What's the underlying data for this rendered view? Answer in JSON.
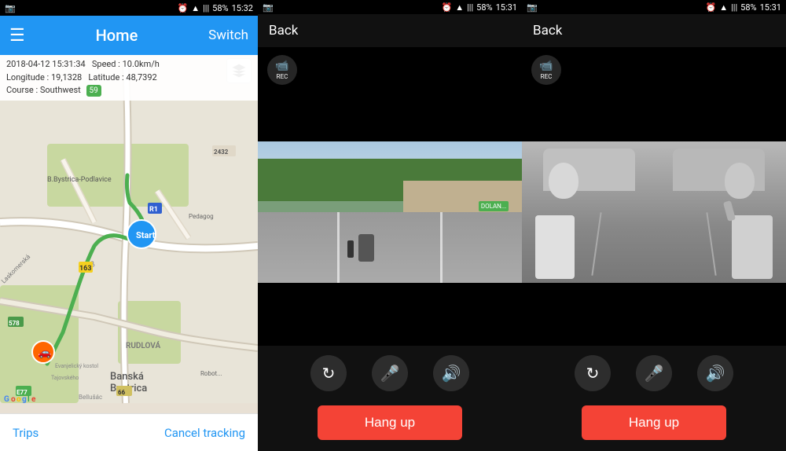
{
  "panel1": {
    "status_bar": {
      "left_icon": "📷",
      "time": "15:32",
      "battery": "58%",
      "signal_bars": "|||"
    },
    "top_bar": {
      "menu_icon": "☰",
      "title": "Home",
      "switch_label": "Switch"
    },
    "info": {
      "datetime": "2018-04-12  15:31:34",
      "speed_label": "Speed :",
      "speed_value": "10.0km/h",
      "longitude_label": "Longitude :",
      "longitude_value": "19,1328",
      "latitude_label": "Latitude :",
      "latitude_value": "48,7392",
      "course_label": "Course :",
      "course_value": "Southwest",
      "course_badge": "59"
    },
    "bottom_bar": {
      "trips_label": "Trips",
      "cancel_label": "Cancel tracking"
    }
  },
  "panel2": {
    "status_bar": {
      "left_icon": "📷",
      "time": "15:31",
      "battery": "58%"
    },
    "back_label": "Back",
    "rec_label": "REC",
    "controls": {
      "rotate": "↻",
      "mic_off": "🎤",
      "speaker": "🔊"
    },
    "hangup_label": "Hang up"
  },
  "panel3": {
    "status_bar": {
      "left_icon": "📷",
      "time": "15:31",
      "battery": "58%"
    },
    "back_label": "Back",
    "rec_label": "REC",
    "controls": {
      "rotate": "↻",
      "mic_off": "🎤",
      "speaker": "🔊"
    },
    "hangup_label": "Hang up"
  },
  "colors": {
    "blue": "#2196F3",
    "red": "#f44336",
    "green": "#4CAF50"
  }
}
